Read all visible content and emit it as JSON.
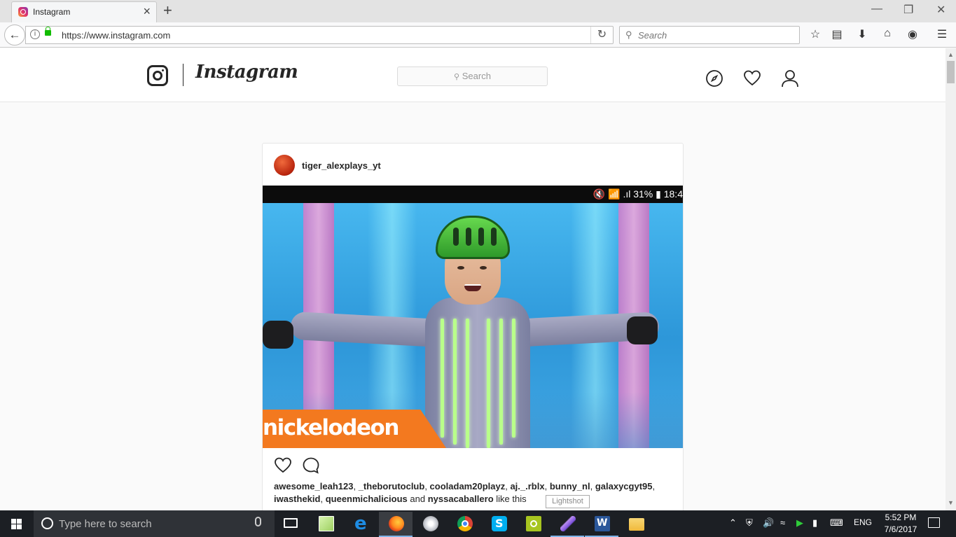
{
  "browser": {
    "tab_title": "Instagram",
    "url": "https://www.instagram.com",
    "search_placeholder": "Search",
    "new_tab_symbol": "+",
    "close_tab_symbol": "×"
  },
  "instagram": {
    "logo_text": "Instagram",
    "search_placeholder": "Search",
    "nav_icons": [
      "compass-icon",
      "heart-icon",
      "profile-icon"
    ]
  },
  "post": {
    "username": "tiger_alexplays_yt",
    "phone_status": "🔇 📶 .ıl 31% ▮ 18:4",
    "video_logo": "nickelodeon",
    "liked_by": [
      "awesome_leah123",
      "_theborutoclub",
      "cooladam20playz",
      "aj._.rblx",
      "bunny_nl",
      "galaxycgyt95",
      "iwasthekid",
      "queenmichalicious"
    ],
    "liked_by_and": "and",
    "liked_by_last": "nyssacaballero",
    "liked_by_suffix": "like this"
  },
  "tooltip": "Lightshot",
  "taskbar": {
    "search_placeholder": "Type here to search",
    "apps": [
      "task-view",
      "file-notes",
      "edge",
      "firefox",
      "paint",
      "chrome",
      "skype",
      "green-app",
      "feather-app",
      "word",
      "file-explorer"
    ],
    "language": "ENG",
    "time": "5:52 PM",
    "date": "7/6/2017"
  },
  "colors": {
    "accent_blue": "#3aa7e6",
    "nick_orange": "#f3791f",
    "helmet_green": "#67d84e"
  }
}
